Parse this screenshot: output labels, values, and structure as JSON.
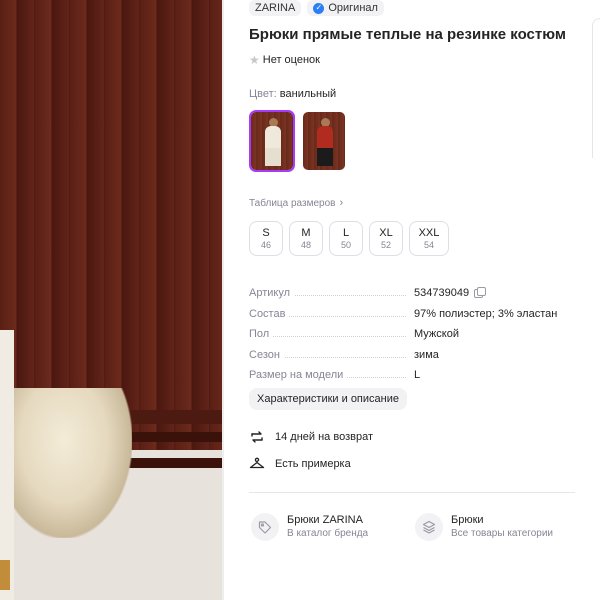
{
  "product": {
    "brand": "ZARINA",
    "original_badge": "Оригинал",
    "title": "Брюки прямые теплые на резинке костюм",
    "rating_text": "Нет оценок"
  },
  "color": {
    "label": "Цвет:",
    "value": "ванильный"
  },
  "size_table_link": "Таблица размеров",
  "sizes": [
    {
      "name": "S",
      "ru": "46"
    },
    {
      "name": "M",
      "ru": "48"
    },
    {
      "name": "L",
      "ru": "50"
    },
    {
      "name": "XL",
      "ru": "52"
    },
    {
      "name": "XXL",
      "ru": "54"
    }
  ],
  "params": [
    {
      "key": "Артикул",
      "value": "534739049"
    },
    {
      "key": "Состав",
      "value": "97% полиэстер; 3% эластан"
    },
    {
      "key": "Пол",
      "value": "Мужской"
    },
    {
      "key": "Сезон",
      "value": "зима"
    },
    {
      "key": "Размер на модели",
      "value": "L"
    }
  ],
  "details_button": "Характеристики и описание",
  "features": {
    "returns": "14 дней на возврат",
    "fitting": "Есть примерка"
  },
  "links": {
    "brand_title": "Брюки ZARINA",
    "brand_sub": "В каталог бренда",
    "category_title": "Брюки",
    "category_sub": "Все товары категории"
  },
  "icons": {
    "verified": "verified-check-icon",
    "star": "star-icon",
    "returns": "return-arrows-icon",
    "fitting": "hanger-icon",
    "brand": "tag-icon",
    "category": "layers-icon"
  },
  "colors": {
    "accent_selected": "#a73afd",
    "verified_blue": "#2a7ff5",
    "muted_text": "#868695"
  }
}
